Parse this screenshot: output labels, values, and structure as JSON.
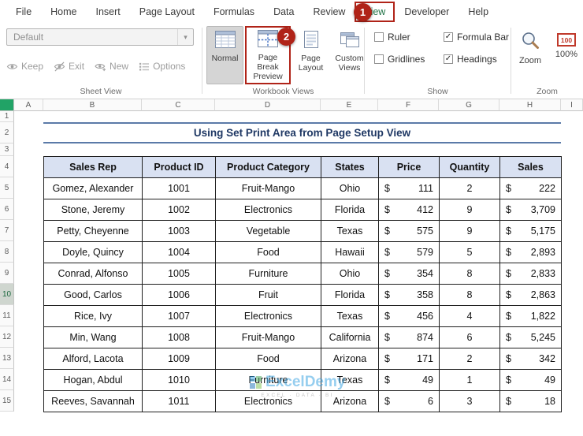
{
  "tabs": [
    {
      "label": "File"
    },
    {
      "label": "Home"
    },
    {
      "label": "Insert"
    },
    {
      "label": "Page Layout"
    },
    {
      "label": "Formulas"
    },
    {
      "label": "Data"
    },
    {
      "label": "Review"
    },
    {
      "label": "View",
      "active": true
    },
    {
      "label": "Developer"
    },
    {
      "label": "Help"
    }
  ],
  "annotations": {
    "step1": "1",
    "step2": "2"
  },
  "ribbon": {
    "sheet_view": {
      "dropdown_value": "Default",
      "buttons": [
        {
          "label": "Keep",
          "icon": "eye-icon"
        },
        {
          "label": "Exit",
          "icon": "eye-off-icon"
        },
        {
          "label": "New",
          "icon": "eye-plus-icon"
        },
        {
          "label": "Options",
          "icon": "list-icon"
        }
      ],
      "label": "Sheet View"
    },
    "workbook_views": {
      "buttons": [
        {
          "label": "Normal",
          "selected": true,
          "highlight": false
        },
        {
          "label": "Page Break Preview",
          "selected": false,
          "highlight": true
        },
        {
          "label": "Page Layout",
          "selected": false,
          "highlight": false
        },
        {
          "label": "Custom Views",
          "selected": false,
          "highlight": false
        }
      ],
      "label": "Workbook Views"
    },
    "show": {
      "checkboxes": [
        {
          "label": "Ruler",
          "checked": false
        },
        {
          "label": "Formula Bar",
          "checked": true
        },
        {
          "label": "Gridlines",
          "checked": false
        },
        {
          "label": "Headings",
          "checked": true
        }
      ],
      "label": "Show"
    },
    "zoom": {
      "zoom_button": "Zoom",
      "zoom_badge": "100",
      "zoom_value": "100%",
      "label": "Zoom"
    }
  },
  "sheet": {
    "columns": [
      "A",
      "B",
      "C",
      "D",
      "E",
      "F",
      "G",
      "H",
      "I"
    ],
    "rows": [
      "1",
      "2",
      "3",
      "4",
      "5",
      "6",
      "7",
      "8",
      "9",
      "10",
      "11",
      "12",
      "13",
      "14",
      "15"
    ],
    "selected_row": "10",
    "title": "Using Set Print Area from Page Setup View",
    "table": {
      "headers": [
        "Sales Rep",
        "Product ID",
        "Product Category",
        "States",
        "Price",
        "Quantity",
        "Sales"
      ],
      "currency_symbol": "$",
      "rows": [
        {
          "rep": "Gomez, Alexander",
          "id": "1001",
          "category": "Fruit-Mango",
          "state": "Ohio",
          "price": "111",
          "qty": "2",
          "sales": "222"
        },
        {
          "rep": "Stone, Jeremy",
          "id": "1002",
          "category": "Electronics",
          "state": "Florida",
          "price": "412",
          "qty": "9",
          "sales": "3,709"
        },
        {
          "rep": "Petty, Cheyenne",
          "id": "1003",
          "category": "Vegetable",
          "state": "Texas",
          "price": "575",
          "qty": "9",
          "sales": "5,175"
        },
        {
          "rep": "Doyle, Quincy",
          "id": "1004",
          "category": "Food",
          "state": "Hawaii",
          "price": "579",
          "qty": "5",
          "sales": "2,893"
        },
        {
          "rep": "Conrad, Alfonso",
          "id": "1005",
          "category": "Furniture",
          "state": "Ohio",
          "price": "354",
          "qty": "8",
          "sales": "2,833"
        },
        {
          "rep": "Good, Carlos",
          "id": "1006",
          "category": "Fruit",
          "state": "Florida",
          "price": "358",
          "qty": "8",
          "sales": "2,863"
        },
        {
          "rep": "Rice, Ivy",
          "id": "1007",
          "category": "Electronics",
          "state": "Texas",
          "price": "456",
          "qty": "4",
          "sales": "1,822"
        },
        {
          "rep": "Min, Wang",
          "id": "1008",
          "category": "Fruit-Mango",
          "state": "California",
          "price": "874",
          "qty": "6",
          "sales": "5,245"
        },
        {
          "rep": "Alford, Lacota",
          "id": "1009",
          "category": "Food",
          "state": "Arizona",
          "price": "171",
          "qty": "2",
          "sales": "342"
        },
        {
          "rep": "Hogan, Abdul",
          "id": "1010",
          "category": "Furniture",
          "state": "Texas",
          "price": "49",
          "qty": "1",
          "sales": "49"
        },
        {
          "rep": "Reeves, Savannah",
          "id": "1011",
          "category": "Electronics",
          "state": "Arizona",
          "price": "6",
          "qty": "3",
          "sales": "18"
        }
      ]
    },
    "watermark": {
      "name": "ExcelDemy",
      "tagline": "EXCEL · DATA · BI"
    }
  },
  "colors": {
    "annotation_red": "#B02318",
    "table_header_fill": "#D9E1F2",
    "title_text": "#1F3864",
    "title_border": "#5B7AA8",
    "active_tab_green": "#217346",
    "select_all_green": "#21A366",
    "watermark_blue": "#2F9FE0"
  }
}
